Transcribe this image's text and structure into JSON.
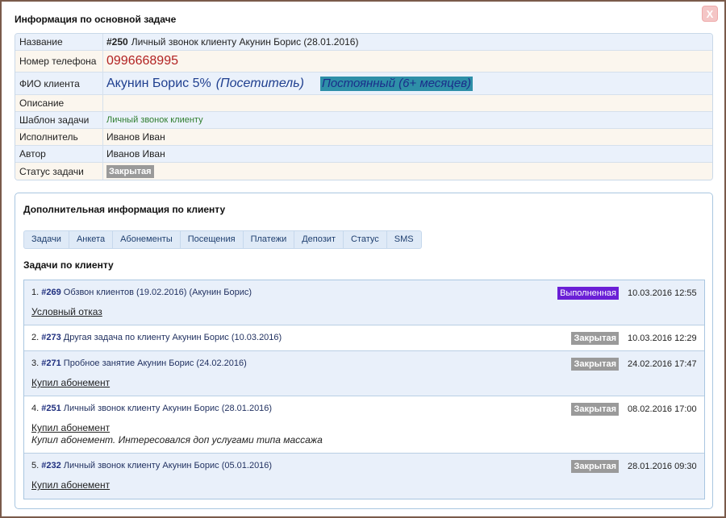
{
  "dialog": {
    "title": "Информация по основной задаче",
    "close_label": "X"
  },
  "info": {
    "rows": [
      {
        "label": "Название",
        "id": "#250",
        "value": "Личный звонок клиенту Акунин Борис (28.01.2016)"
      },
      {
        "label": "Номер телефона",
        "value": "0996668995"
      },
      {
        "label": "ФИО клиента",
        "name": "Акунин Борис 5%",
        "role": "(Посетитель)",
        "status": "Постоянный (6+ месяцев)"
      },
      {
        "label": "Описание",
        "value": ""
      },
      {
        "label": "Шаблон задачи",
        "value": "Личный звонок клиенту"
      },
      {
        "label": "Исполнитель",
        "value": "Иванов Иван"
      },
      {
        "label": "Автор",
        "value": "Иванов Иван"
      },
      {
        "label": "Статус задачи",
        "value": "Закрытая"
      }
    ]
  },
  "extra": {
    "title": "Дополнительная информация по клиенту",
    "tabs": [
      "Задачи",
      "Анкета",
      "Абонементы",
      "Посещения",
      "Платежи",
      "Депозит",
      "Статус",
      "SMS"
    ],
    "tasks_heading": "Задачи по клиенту",
    "tasks": [
      {
        "num": "1.",
        "id": "#269",
        "title": "Обзвон клиентов (19.02.2016) (Акунин Борис)",
        "status": "Выполненная",
        "date": "10.03.2016 12:55",
        "result": "Условный отказ",
        "note": ""
      },
      {
        "num": "2.",
        "id": "#273",
        "title": "Другая задача по клиенту Акунин Борис (10.03.2016)",
        "status": "Закрытая",
        "date": "10.03.2016 12:29",
        "result": "",
        "note": ""
      },
      {
        "num": "3.",
        "id": "#271",
        "title": "Пробное занятие Акунин Борис (24.02.2016)",
        "status": "Закрытая",
        "date": "24.02.2016 17:47",
        "result": "Купил абонемент",
        "note": ""
      },
      {
        "num": "4.",
        "id": "#251",
        "title": "Личный звонок клиенту Акунин Борис (28.01.2016)",
        "status": "Закрытая",
        "date": "08.02.2016 17:00",
        "result": "Купил абонемент",
        "note": "Купил абонемент. Интересовался доп услугами типа массажа"
      },
      {
        "num": "5.",
        "id": "#232",
        "title": "Личный звонок клиенту Акунин Борис (05.01.2016)",
        "status": "Закрытая",
        "date": "28.01.2016 09:30",
        "result": "Купил абонемент",
        "note": ""
      }
    ]
  },
  "colors": {
    "status_done": "#6a1fd6",
    "status_closed": "#9a9a9a",
    "client_status_bg": "#2e8fa8",
    "phone": "#b22222"
  }
}
